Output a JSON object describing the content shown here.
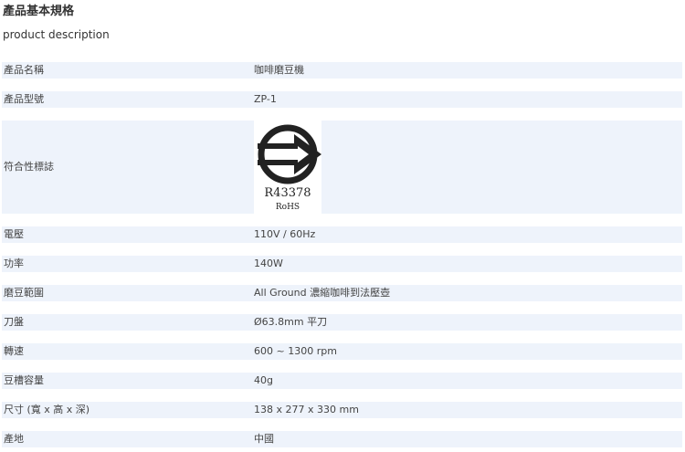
{
  "header": {
    "title": "產品基本規格",
    "subtitle": "product description"
  },
  "specs": [
    {
      "label": "產品名稱",
      "value": "咖啡磨豆機"
    },
    {
      "label": "產品型號",
      "value": "ZP-1"
    },
    {
      "label": "符合性標誌",
      "value": "",
      "mark": {
        "code": "R43378",
        "text": "RoHS",
        "icon": "bsmi-inspection-mark-icon"
      }
    },
    {
      "label": "電壓",
      "value": "110V / 60Hz"
    },
    {
      "label": "功率",
      "value": "140W"
    },
    {
      "label": "磨豆範圍",
      "value": "All Ground 濃縮咖啡到法壓壺"
    },
    {
      "label": "刀盤",
      "value": "Ø63.8mm 平刀"
    },
    {
      "label": "轉速",
      "value": "600 ~ 1300 rpm"
    },
    {
      "label": "豆槽容量",
      "value": "40g"
    },
    {
      "label": "尺寸 (寬 x 高 x 深)",
      "value": "138 x 277 x 330 mm"
    },
    {
      "label": "產地",
      "value": "中國"
    }
  ],
  "colors": {
    "row_background": "#eef3fb",
    "text": "#333333"
  }
}
